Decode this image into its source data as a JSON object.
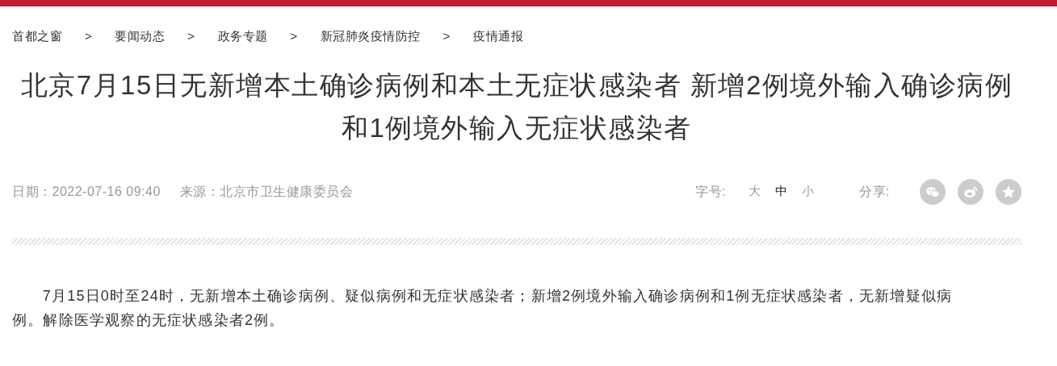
{
  "breadcrumb": [
    "首都之窗",
    "要闻动态",
    "政务专题",
    "新冠肺炎疫情防控",
    "疫情通报"
  ],
  "breadcrumb_separator": ">",
  "title": "北京7月15日无新增本土确诊病例和本土无症状感染者 新增2例境外输入确诊病例和1例境外输入无症状感染者",
  "date": "日期：2022-07-16 09:40",
  "source": "来源：北京市卫生健康委员会",
  "font_size_label": "字号:",
  "font_sizes": [
    {
      "label": "大",
      "selected": false
    },
    {
      "label": "中",
      "selected": true
    },
    {
      "label": "小",
      "selected": false
    }
  ],
  "share_label": "分享:",
  "share_buttons": [
    {
      "kind": "wechat"
    },
    {
      "kind": "weibo"
    },
    {
      "kind": "qzone"
    }
  ],
  "paragraphs": [
    "7月15日0时至24时，无新增本土确诊病例、疑似病例和无症状感染者；新增2例境外输入确诊病例和1例无症状感染者，无新增疑似病例。解除医学观察的无症状感染者2例。"
  ]
}
